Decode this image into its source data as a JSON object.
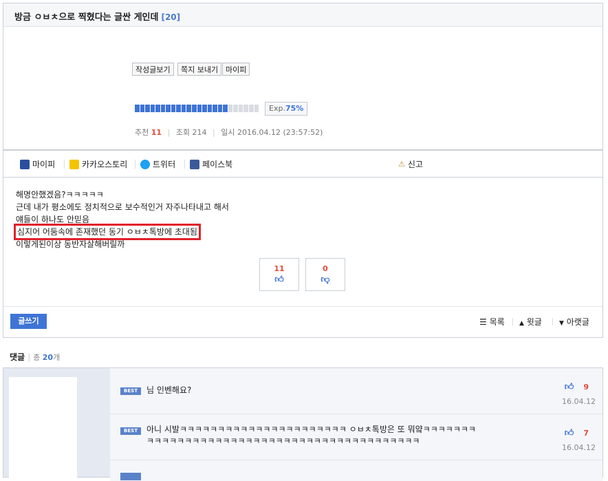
{
  "post": {
    "title": "방금 ㅇㅂㅊ으로 찍혔다는 글싼 게인데",
    "comment_count_badge": "[20]"
  },
  "profile": {
    "buttons": [
      "작성글보기",
      "쪽지 보내기",
      "마이피"
    ],
    "exp_label": "Exp.",
    "exp_value": "75%",
    "exp_fraction": 0.75,
    "recommend_label": "추천",
    "recommend_value": "11",
    "views_label": "조회",
    "views_value": "214",
    "date_label": "일시",
    "date_value": "2016.04.12 (23:57:52)"
  },
  "share": {
    "mypi": "마이피",
    "kakao": "카카오스토리",
    "twitter": "트위터",
    "facebook": "페이스북",
    "report": "신고"
  },
  "body": {
    "lines": [
      "해명안했겠음?ㅋㅋㅋㅋㅋ",
      "근데 내가 평소에도 정치적으로 보수적인거 자주나타내고 해서",
      "얘들이 하나도 안믿음",
      "심지어 어둠속에 존재했던 동기 ㅇㅂㅊ톡방에 초대됨",
      "이렇게된이상 동반자살해버릴까"
    ],
    "highlight_index": 3
  },
  "votes": {
    "up": "11",
    "down": "0"
  },
  "footer": {
    "write_label": "글쓰기",
    "list_label": "목록",
    "prev_label": "윗글",
    "next_label": "아랫글"
  },
  "comments": {
    "header": "댓글",
    "total_prefix": "총",
    "total_value": "20",
    "total_suffix": "개",
    "badge": "BEST",
    "items": [
      {
        "text": "님 인벤해요?",
        "likes": "9",
        "date": "16.04.12"
      },
      {
        "text_line1": "아니 시발ㅋㅋㅋㅋㅋㅋㅋㅋㅋㅋㅋㅋㅋㅋㅋㅋㅋㅋㅋㅋㅋㅋ ㅇㅂㅊ톡방은 또 뭐얔ㅋㅋㅋㅋㅋㅋㅋ",
        "text_line2": "ㅋㅋㅋㅋㅋㅋㅋㅋㅋㅋㅋㅋㅋㅋㅋㅋㅋㅋㅋㅋㅋㅋㅋㅋㅋㅋㅋㅋㅋㅋㅋㅋㅋㅋㅋㅋ",
        "likes": "7",
        "date": "16.04.12"
      }
    ]
  },
  "colors": {
    "accent": "#3e74d6",
    "highlight_border": "#e0202a",
    "count_red": "#e24b3b"
  }
}
